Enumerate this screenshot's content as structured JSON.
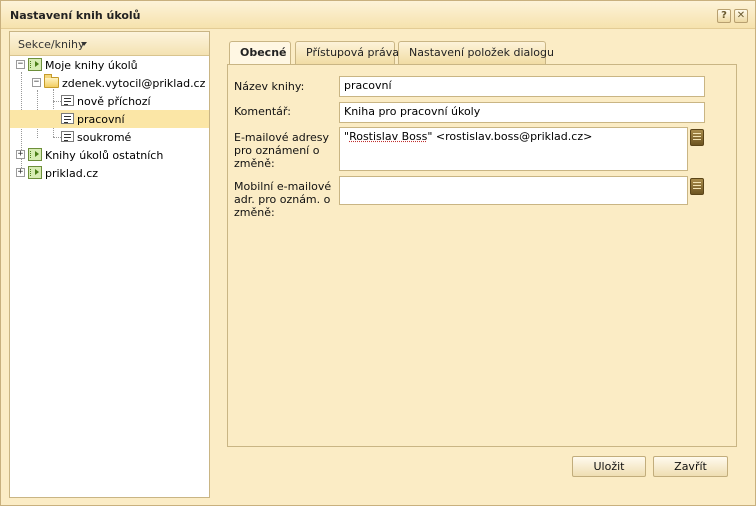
{
  "window": {
    "title": "Nastavení knih úkolů",
    "help_symbol": "?",
    "close_symbol": "✕"
  },
  "sidebar": {
    "header_label": "Sekce/knihy",
    "tree": [
      {
        "label": "Moje knihy úkolů",
        "expanded": true,
        "icon": "task-book-icon"
      },
      {
        "label": "zdenek.vytocil@priklad.cz",
        "expanded": true,
        "icon": "folder-icon"
      },
      {
        "label": "nově příchozí",
        "icon": "task-list-icon"
      },
      {
        "label": "pracovní",
        "icon": "task-list-icon",
        "selected": true
      },
      {
        "label": "soukromé",
        "icon": "task-list-icon"
      },
      {
        "label": "Knihy úkolů ostatních",
        "expanded": false,
        "icon": "task-book-icon"
      },
      {
        "label": "priklad.cz",
        "expanded": false,
        "icon": "task-book-icon"
      }
    ],
    "expand_symbol": "+",
    "collapse_symbol": "−"
  },
  "tabs": [
    {
      "label": "Obecné",
      "active": true
    },
    {
      "label": "Přístupová práva"
    },
    {
      "label": "Nastavení položek dialogu"
    }
  ],
  "form": {
    "name_label": "Název knihy:",
    "name_value": "pracovní",
    "comment_label": "Komentář:",
    "comment_value": "Kniha pro pracovní úkoly",
    "email_label": "E-mailové adresy pro oznámení o změně:",
    "email_value_prefix": "\"",
    "email_value_name": "Rostislav Boss",
    "email_value_suffix": "\" <rostislav.boss@priklad.cz>",
    "mobile_label": "Mobilní e-mailové adr. pro oznám. o změně:",
    "mobile_value": ""
  },
  "buttons": {
    "save_label": "Uložit",
    "close_label": "Zavřít"
  },
  "colors": {
    "window_bg": "#fbecc5",
    "selected_row": "#fbe6a6",
    "border": "#c9b584"
  }
}
